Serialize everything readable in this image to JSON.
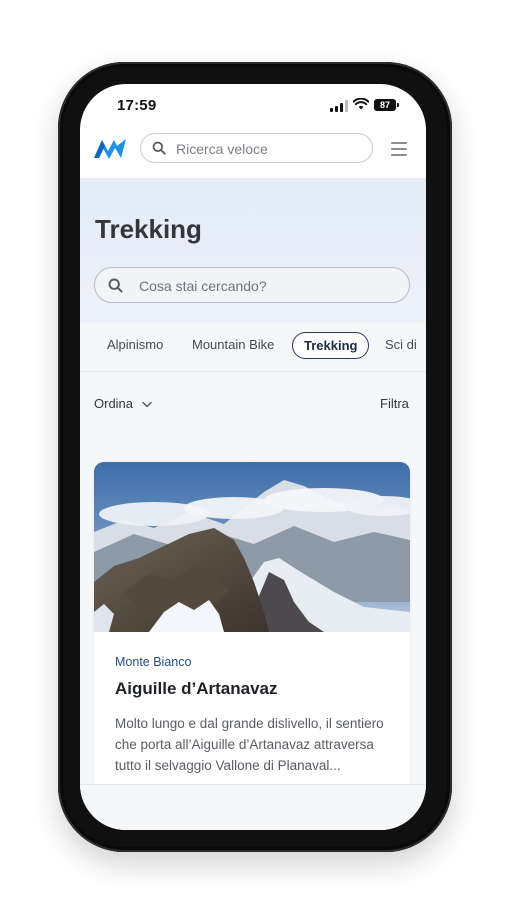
{
  "status_bar": {
    "time": "17:59",
    "battery": "87"
  },
  "header": {
    "search_placeholder": "Ricerca veloce",
    "logo": "app-logo",
    "menu_icon": "hamburger-icon"
  },
  "hero": {
    "title": "Trekking",
    "search_placeholder": "Cosa stai cercando?"
  },
  "tabs": [
    {
      "label": "Alpinismo",
      "active": false
    },
    {
      "label": "Mountain Bike",
      "active": false
    },
    {
      "label": "Trekking",
      "active": true
    },
    {
      "label": "Sci di",
      "active": false
    }
  ],
  "toolbar": {
    "sort_label": "Ordina",
    "filter_label": "Filtra"
  },
  "card": {
    "region": "Monte Bianco",
    "title": "Aiguille d’Artanavaz",
    "description": "Molto lungo e dal grande dislivello, il sentiero che porta all’Aiguille d’Artanavaz attraversa tutto il selvaggio Vallone di Planaval..."
  },
  "colors": {
    "accent": "#223a63",
    "hero_bg": "#e3ecf8",
    "region_link": "#274e87",
    "logo": "#1e90e8"
  }
}
